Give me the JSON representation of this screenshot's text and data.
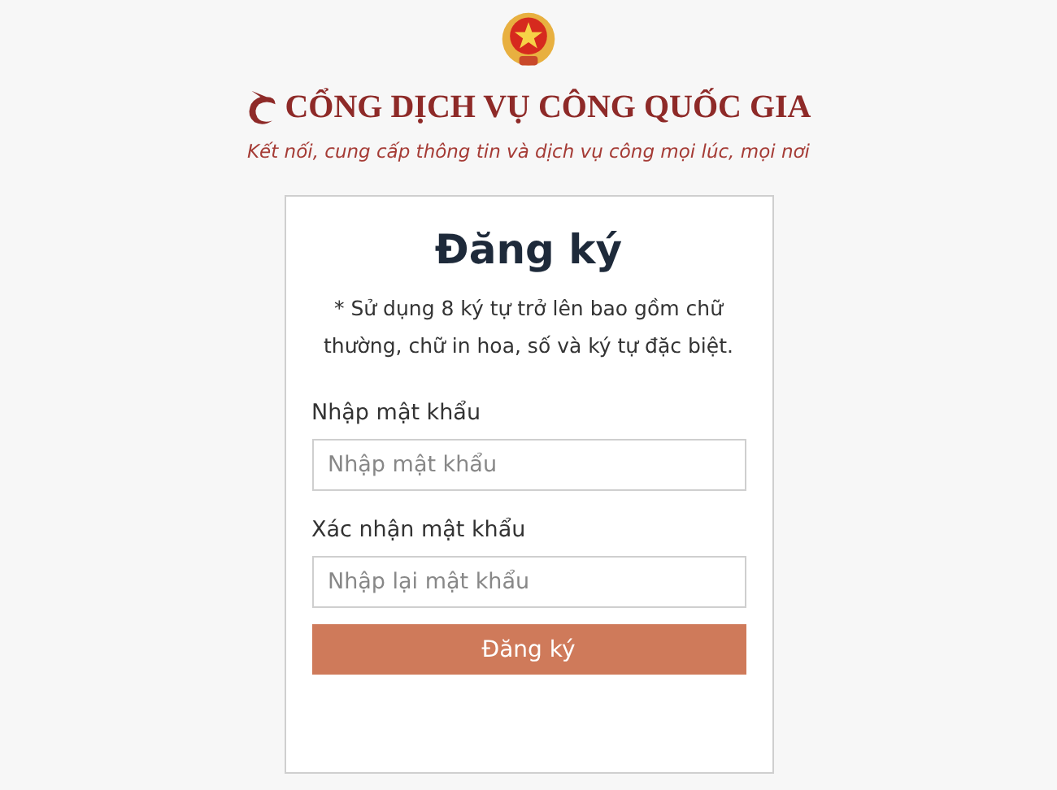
{
  "header": {
    "title": "CỔNG DỊCH VỤ CÔNG QUỐC GIA",
    "tagline": "Kết nối, cung cấp thông tin và dịch vụ công mọi lúc, mọi nơi"
  },
  "form": {
    "heading": "Đăng ký",
    "hint": "* Sử dụng 8 ký tự trở lên bao gồm chữ thường, chữ in hoa, số và ký tự đặc biệt.",
    "fields": [
      {
        "label": "Nhập mật khẩu",
        "placeholder": "Nhập mật khẩu"
      },
      {
        "label": "Xác nhận mật khẩu",
        "placeholder": "Nhập lại mật khẩu"
      }
    ],
    "submit": "Đăng ký"
  }
}
